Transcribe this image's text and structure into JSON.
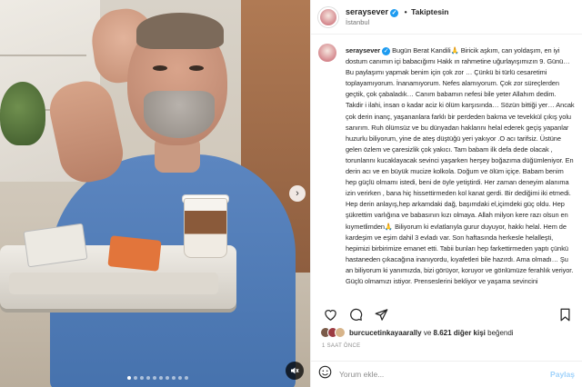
{
  "post": {
    "username": "seraysever",
    "follow_separator": "•",
    "follow_label": "Takiptesin",
    "location": "İstanbul"
  },
  "caption": {
    "username": "seraysever",
    "text": "Bugün Berat Kandili🙏 Biricik aşkım, can yoldaşım, en iyi dostum canımın içi babacığımı Hakk ın rahmetine uğurlayışımızın 9. Günü… Bu paylaşımı yapmak benim için çok zor … Çünkü bi türlü cesaretimi toplayamıyorum. İnanamıyorum. Nefes alamıyorum. Çok zor süreçlerden geçtik, çok çabaladık… Canım babamın nefesi bile yeter Allahım dedim. Takdir i ilahi, insan o kadar aciz ki ölüm karşısında… Sözün bittiği yer… Ancak çok derin inanç, yaşananlara farklı bir perdeden bakma ve tevekkül çıkış yolu sanırım. Ruh ölümsüz ve bu dünyadan haklarını helal ederek geçiş yapanlar huzurlu biliyorum, yine de ateş düştüğü yeri yakıyor .O acı tarifsiz. Üstüne gelen özlem ve çaresizlik çok yakıcı. Tam babam ilk defa dede olacak , torunlarını kucaklayacak sevinci yaşarken herşey boğazıma düğümleniyor. En derin acı ve en büyük mucize kolkola. Doğum ve ölüm içiçe. Babam benim hep güçlü olmamı istedi, beni de öyle yetiştirdi. Her zaman deneyim alanıma izin verirken , bana hiç hissettirmeden kol kanat gerdi. Bir dediğimi iki etmedi. Hep derin anlayış,hep arkamdaki dağ, başımdaki el,içimdeki güç oldu. Hep şükrettim varlığına ve babasının kızı olmaya. Allah milyon kere razı olsun en kıymetlimden🙏 Biliyorum ki evlatlarıyla gurur duyuyor, hakkı helal. Hem de kardeşim ve eşim dahil 3 evladı var. Son haftasında herkesle helalleşti, hepimizi birbirimize emanet etti. Tabii bunları hep farkettirmeden yaptı çünkü hastaneden çıkacağına inanıyordu, kıyafetleri bile hazırdı. Ama olmadı… Şu an biliyorum ki yanımızda, bizi görüyor, koruyor ve gönlümüze ferahlık veriyor. Güçlü olmamızı istiyor. Prenseslerini bekliyor ve yaşama sevincini"
  },
  "likes": {
    "liker": "burcucetinkayaarally",
    "connector": " ve ",
    "others": "8.621 diğer kişi",
    "suffix": " beğendi"
  },
  "timestamp": "1 SAAT ÖNCE",
  "comment": {
    "placeholder": "Yorum ekle...",
    "post_label": "Paylaş"
  },
  "carousel": {
    "slide_count": 10,
    "active_index": 0
  },
  "icons": {
    "like": "heart-icon",
    "comment": "comment-icon",
    "share": "share-icon",
    "save": "bookmark-icon",
    "emoji": "emoji-icon",
    "mute": "mute-icon",
    "next": "chevron-right-icon"
  },
  "colors": {
    "verified": "#1d9bf0",
    "post_button": "#9fd2fb",
    "hospital_gown": "#4f7bb6"
  }
}
